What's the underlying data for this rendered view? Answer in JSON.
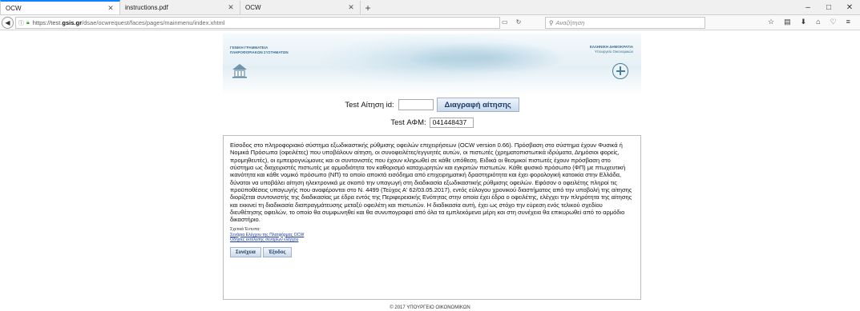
{
  "browser": {
    "tabs": [
      {
        "label": "OCW",
        "active": true
      },
      {
        "label": "instructions.pdf",
        "active": false
      },
      {
        "label": "OCW",
        "active": false
      }
    ],
    "new_tab": "+",
    "url_prefix": "https://test.",
    "url_domain": "gsis.gr",
    "url_path": "/dsae/ocwrequest/faces/pages/mainmenu/index.xhtml",
    "search_placeholder": "Αναζήτηση",
    "window_controls": {
      "minimize": "–",
      "maximize": "□",
      "close": "✕"
    }
  },
  "banner": {
    "org_line1": "ΓΕΝΙΚΗ ΓΡΑΜΜΑΤΕΙΑ",
    "org_line2": "ΠΛΗΡΟΦΟΡΙΑΚΩΝ ΣΥΣΤΗΜΑΤΩΝ",
    "gov_line1": "ΕΛΛΗΝΙΚΗ ΔΗΜΟΚΡΑΤΙΑ",
    "gov_line2": "Υπουργείο Οικονομικών"
  },
  "test_request": {
    "label": "Test Αίτηση id:",
    "id_value": "",
    "delete_button": "Διαγραφή αίτησης"
  },
  "test_afm": {
    "label": "Test ΑΦΜ:",
    "value": "041448437"
  },
  "info": {
    "text": "Είσοδος στο πληροφοριακό σύστημα εξωδικαστικής ρύθμισης οφειλών επιχειρήσεων (OCW version 0.66). Πρόσβαση στο σύστημα έχουν Φυσικά ή Νομικά Πρόσωπα (οφειλέτες) που υποβάλουν αίτηση, οι συνοφειλέτες/εγγυητές αυτών, οι πιστωτές (χρηματοπιστωτικά ιδρύματα, Δημόσιοι φορείς, προμηθευτές), οι εμπειρογνώμονες και οι συντονιστές που έχουν κληρωθεί σε κάθε υπόθεση. Ειδικά οι θεσμικοί πιστωτές έχουν πρόσβαση στο σύστημα ως διαχειριστές πιστωτές με αρμοδιότητα τον καθορισμό καταχωρητών και εγκριτών πιστωτών. Κάθε φυσικό πρόσωπο (ΦΠ) με πτωχευτική ικανότητα και κάθε νομικό πρόσωπο (ΝΠ) το οποίο αποκτά εισόδημα από επιχειρηματική δραστηριότητα και έχει φορολογική κατοικία στην Ελλάδα, δύναται να υποβάλει αίτηση ηλεκτρονικά με σκοπό την υπαγωγή στη διαδικασία εξωδικαστικής ρύθμισης οφειλών. Εφόσον ο οφειλέτης πληροί τις προϋποθέσεις υπαγωγής που αναφέρονται στο Ν. 4499 (Τεύχος Α' 62/03.05.2017), εντός εύλογου χρονικού διαστήματος από την υποβολή της αίτησης διορίζεται συντονιστής της διαδικασίας με έδρα εντός της Περιφερειακής Ενότητας στην οποία έχει έδρα ο οφειλέτης, ελέγχει την πληρότητα της αίτησης και εκκινεί τη διαδικασία διαπραγμάτευσης μεταξύ οφειλέτη και πιστωτών. Η διαδικασία αυτή, έχει ως στόχο την εύρεση ενός τελικού σχεδίου διευθέτησης οφειλών, το οποίο θα συμφωνηθεί και θα συνυπογραφεί από όλα τα εμπλεκόμενα μέρη και στη συνέχεια θα επικυρωθεί από το αρμόδιο δικαστήριο.",
    "related_label": "Σχετικά Έντυπα:",
    "links": [
      "Σενάρια Ελέγχου της Πλατφόρμας OCW",
      "Οδηγίες εκτέλεσης σεναρίων ελέγχου"
    ],
    "continue_button": "Συνέχεια",
    "exit_button": "Έξοδος"
  },
  "footer": "© 2017 ΥΠΟΥΡΓΕΙΟ ΟΙΚΟΝΟΜΙΚΩΝ"
}
